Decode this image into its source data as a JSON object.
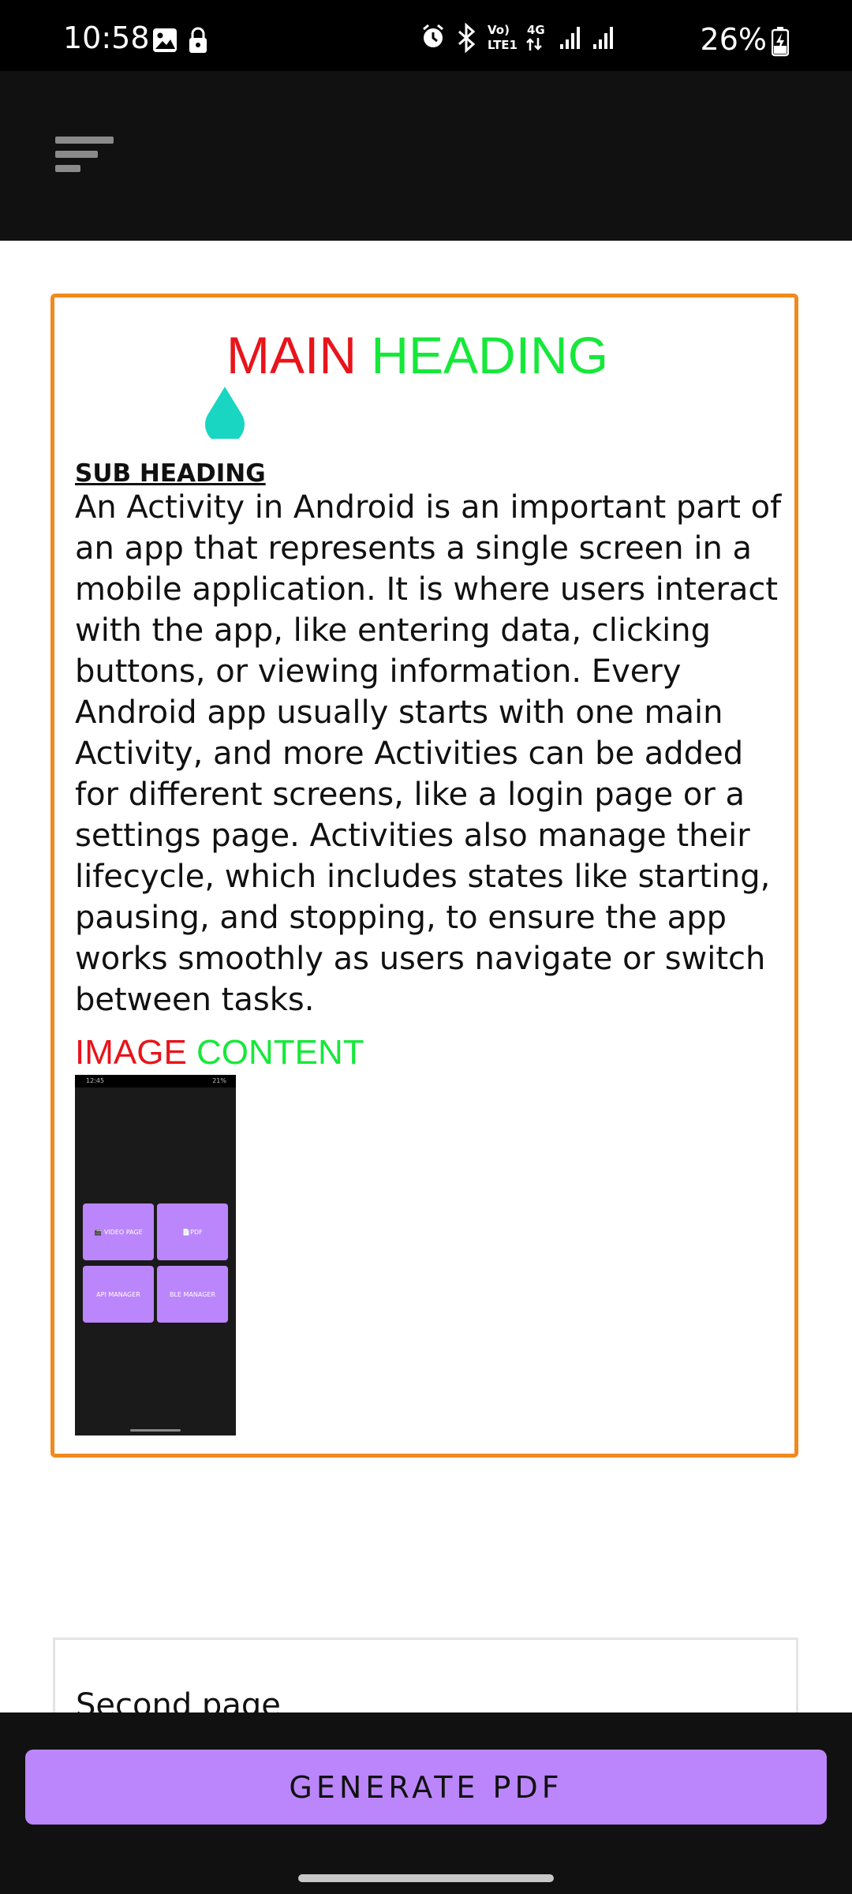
{
  "status_bar": {
    "time": "10:58",
    "battery": "26%",
    "left_icons": [
      "image-icon",
      "lock-icon"
    ],
    "right_icons": [
      "alarm-icon",
      "bluetooth-icon",
      "volte-icon",
      "4g-icon",
      "signal-icon",
      "signal-icon",
      "battery-charging-icon"
    ],
    "volte_text_1": "Vo)",
    "volte_text_2": "LTE1",
    "network_text": "4G"
  },
  "app_bar": {
    "menu_icon": "sort-menu-icon",
    "background": "#111111"
  },
  "pdf_preview": {
    "border_color": "#f08a1e",
    "main_heading": {
      "part1": "MAIN",
      "part2": "HEADING"
    },
    "sub_heading": "SUB HEADING",
    "body_text": "An Activity in Android is an important part of an app that represents a single screen in a mobile application. It is where users interact with the app, like entering data, clicking buttons, or viewing information. Every Android app usually starts with one main Activity, and more Activities can be added for different screens, like a login page or a settings page. Activities also manage their lifecycle, which includes states like starting, pausing, and stopping, to ensure the app works smoothly as users navigate or switch between tasks.",
    "image_heading": {
      "part1": "IMAGE",
      "part2": "CONTENT"
    },
    "thumbnail": {
      "status_time": "12:45",
      "status_right": "21%",
      "buttons": [
        "🎬 VIDEO PAGE",
        "📄PDF",
        "API MANAGER",
        "BLE MANAGER"
      ]
    }
  },
  "second_page": {
    "label": "Second page"
  },
  "generate_button": {
    "label": "GENERATE PDF",
    "color": "#bb86fc"
  }
}
